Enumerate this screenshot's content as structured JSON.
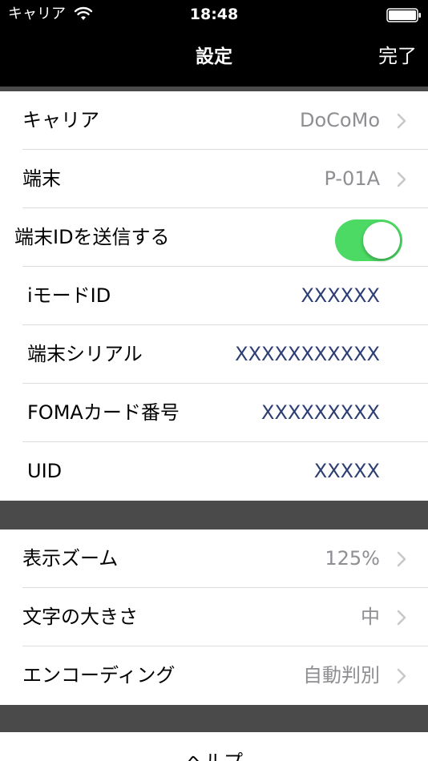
{
  "status_bar": {
    "carrier": "キャリア",
    "time": "18:48"
  },
  "nav": {
    "title": "設定",
    "done_label": "完了"
  },
  "group1": {
    "carrier": {
      "label": "キャリア",
      "value": "DoCoMo"
    },
    "device": {
      "label": "端末",
      "value": "P-01A"
    },
    "send_id": {
      "label": "端末IDを送信する",
      "enabled": true
    },
    "imode_id": {
      "label": "iモードID",
      "value": "XXXXXX"
    },
    "serial": {
      "label": "端末シリアル",
      "value": "XXXXXXXXXXX"
    },
    "foma": {
      "label": "FOMAカード番号",
      "value": "XXXXXXXXX"
    },
    "uid": {
      "label": "UID",
      "value": "XXXXX"
    }
  },
  "group2": {
    "zoom": {
      "label": "表示ズーム",
      "value": "125%"
    },
    "font_size": {
      "label": "文字の大きさ",
      "value": "中"
    },
    "encoding": {
      "label": "エンコーディング",
      "value": "自動判別"
    }
  },
  "help": {
    "label": "ヘルプ"
  },
  "colors": {
    "toggle_on": "#4cd964",
    "id_value": "#2c3e73",
    "secondary_text": "#8e8e93",
    "background": "#4a4a4a"
  }
}
